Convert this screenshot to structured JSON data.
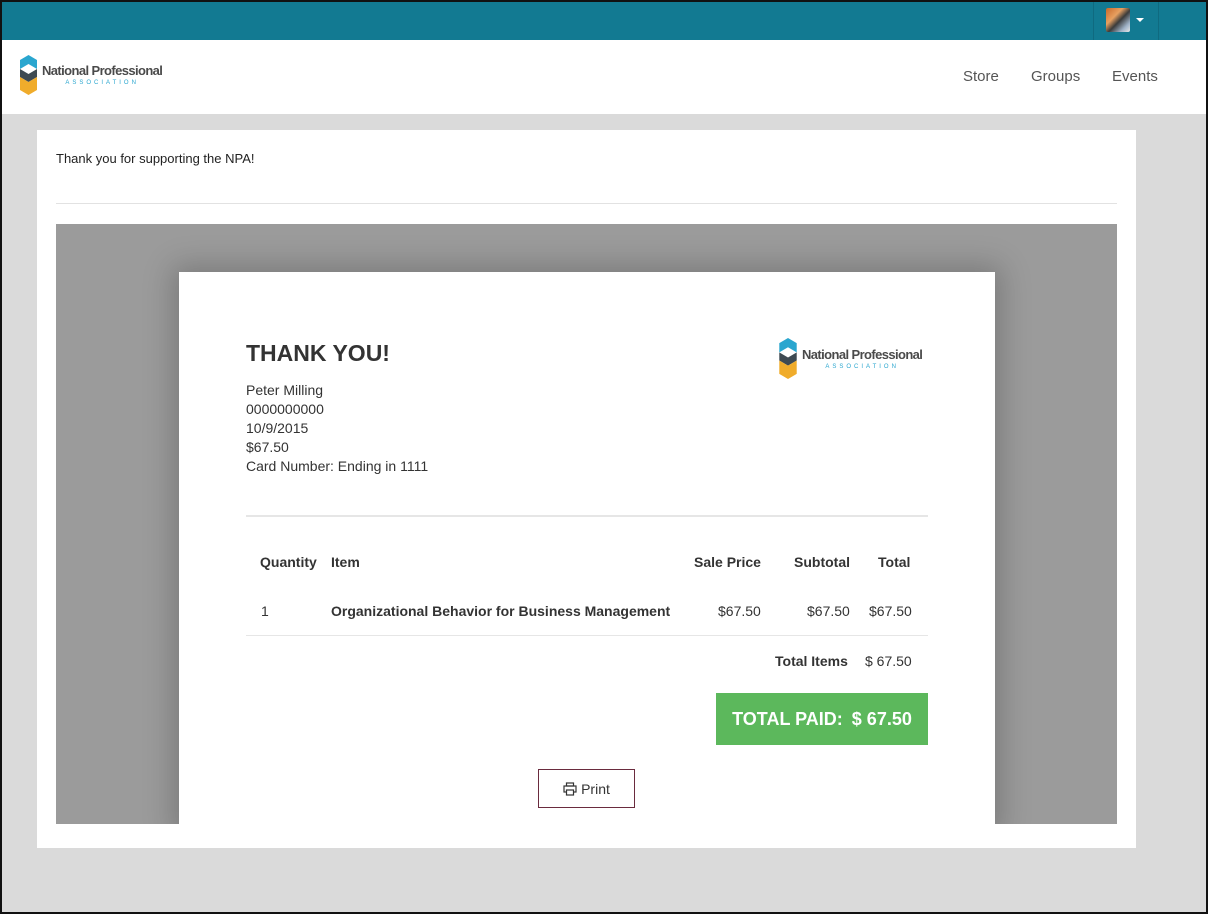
{
  "header": {
    "brand_name": "National Professional",
    "brand_sub": "ASSOCIATION",
    "nav": [
      "Store",
      "Groups",
      "Events"
    ]
  },
  "user_menu": {
    "avatar_icon": "user-avatar",
    "caret_icon": "caret-down-icon"
  },
  "page": {
    "message": "Thank you for supporting the NPA!"
  },
  "receipt": {
    "title": "THANK YOU!",
    "customer_name": "Peter Milling",
    "account_number": "0000000000",
    "date": "10/9/2015",
    "amount": "$67.50",
    "card": "Card Number: Ending in 1111",
    "columns": {
      "quantity": "Quantity",
      "item": "Item",
      "sale_price": "Sale Price",
      "subtotal": "Subtotal",
      "total": "Total"
    },
    "rows": [
      {
        "quantity": "1",
        "item": "Organizational Behavior for Business Management",
        "sale_price": "$67.50",
        "subtotal": "$67.50",
        "total": "$67.50"
      }
    ],
    "total_items_label": "Total Items",
    "total_items_value": "$ 67.50",
    "total_paid_label": "TOTAL PAID:",
    "total_paid_value": "$ 67.50",
    "print_label": "Print"
  },
  "colors": {
    "topbar": "#127a92",
    "accent_green": "#5cb85c",
    "logo_blue": "#2aa6cf",
    "logo_yellow": "#f0ac2b",
    "logo_dark": "#3e4a52"
  }
}
